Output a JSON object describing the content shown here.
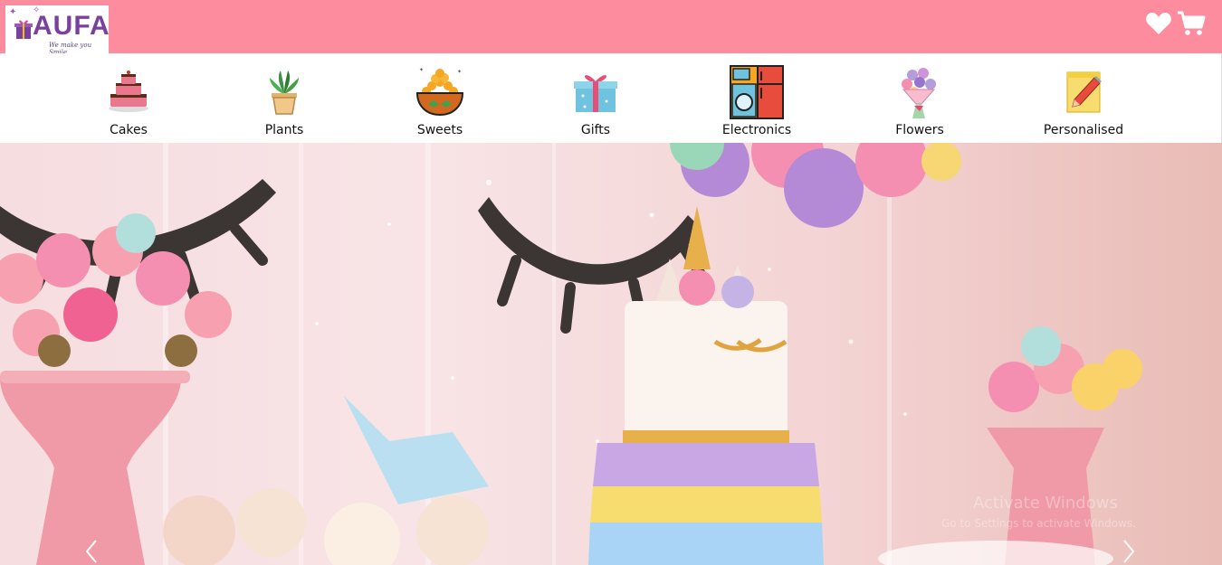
{
  "brand": {
    "name": "AUFA",
    "tagline": "We make you Smile"
  },
  "header": {
    "icons": [
      "heart-icon",
      "cart-icon"
    ]
  },
  "categories": [
    {
      "label": "Cakes",
      "icon": "cake-icon"
    },
    {
      "label": "Plants",
      "icon": "plant-icon"
    },
    {
      "label": "Sweets",
      "icon": "sweets-icon"
    },
    {
      "label": "Gifts",
      "icon": "gift-icon"
    },
    {
      "label": "Electronics",
      "icon": "appliances-icon"
    },
    {
      "label": "Flowers",
      "icon": "bouquet-icon"
    },
    {
      "label": "Personalised",
      "icon": "notepad-pencil-icon"
    }
  ],
  "hero": {
    "watermark_line1": "Activate Windows",
    "watermark_line2": "Go to Settings to activate Windows."
  },
  "colors": {
    "topbar": "#fd8c9e",
    "background": "#ffffff"
  }
}
